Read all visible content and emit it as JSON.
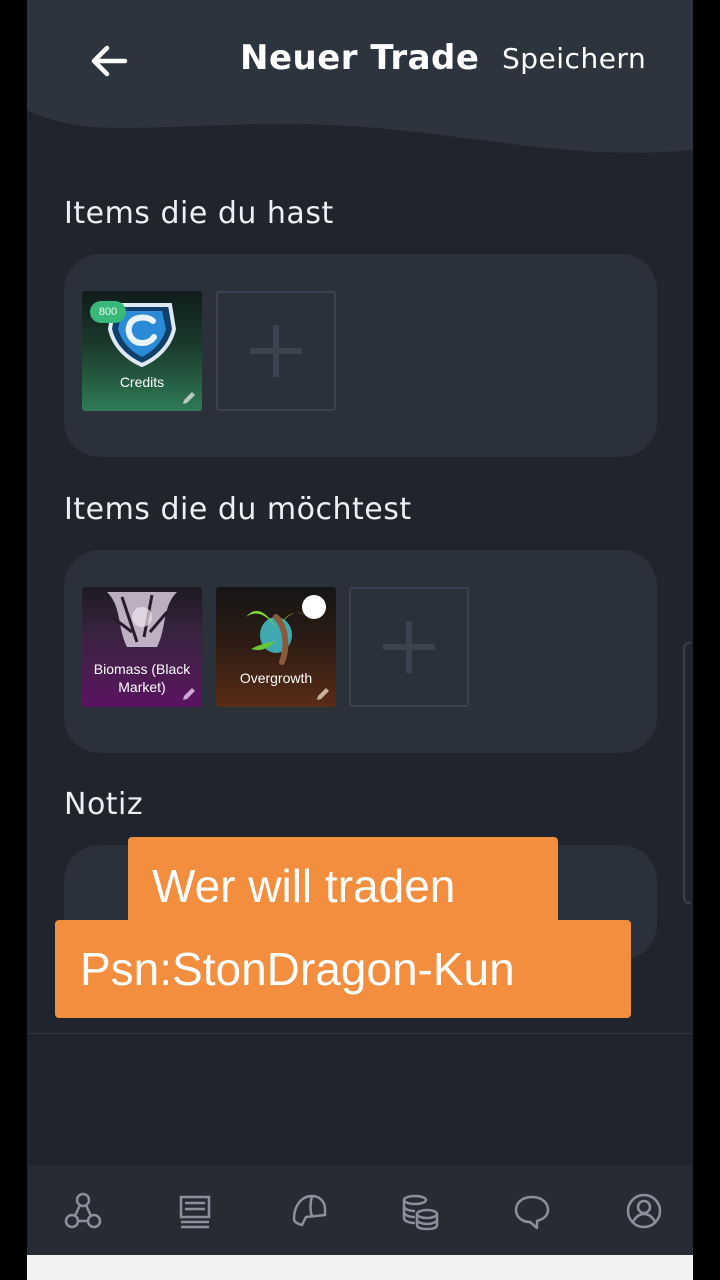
{
  "header": {
    "title": "Neuer Trade",
    "save_label": "Speichern",
    "back_icon": "arrow-left-icon"
  },
  "have_section": {
    "title": "Items die du hast",
    "items": [
      {
        "label": "Credits",
        "badge": "800",
        "icon": "credits-logo-icon",
        "bg_color": "#2f7b56"
      }
    ],
    "add_icon": "plus-icon"
  },
  "want_section": {
    "title": "Items die du möchtest",
    "items": [
      {
        "label": "Biomass (Black Market)",
        "label_line1": "Biomass (Black",
        "label_line2": "Market)",
        "icon": "biomass-decal-icon",
        "bg_color": "#5a1461"
      },
      {
        "label": "Overgrowth",
        "icon": "overgrowth-decal-icon",
        "bg_color": "#5a2c16"
      }
    ],
    "add_icon": "plus-icon"
  },
  "note_section": {
    "title": "Notiz",
    "value": ""
  },
  "caption": {
    "line1": "Wer will traden",
    "line2": "Psn:StonDragon-Kun",
    "color": "#f28e3e"
  },
  "bottom_nav": [
    {
      "name": "network-icon"
    },
    {
      "name": "monitor-icon"
    },
    {
      "name": "helmet-icon"
    },
    {
      "name": "coins-icon"
    },
    {
      "name": "chat-icon"
    },
    {
      "name": "profile-icon"
    }
  ],
  "colors": {
    "background": "#1f242d",
    "panel": "#2b313b",
    "header": "#2e343e",
    "accent_green": "#38b879"
  }
}
